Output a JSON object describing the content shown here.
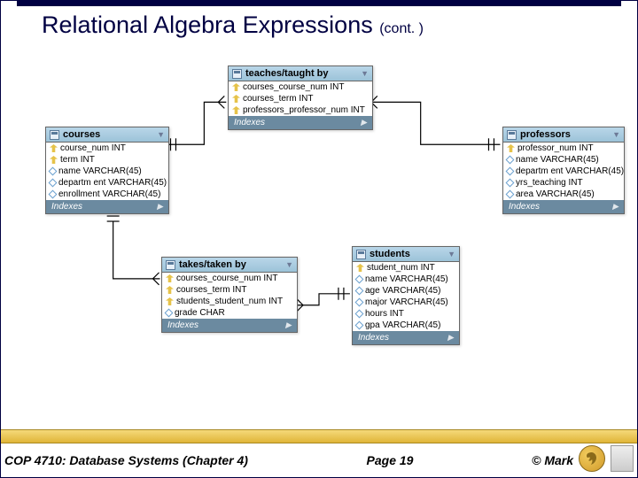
{
  "title_main": "Relational Algebra Expressions ",
  "title_cont": "(cont. )",
  "tables": {
    "courses": {
      "name": "courses",
      "idx": "Indexes",
      "cols": [
        {
          "k": "key",
          "t": "course_num INT"
        },
        {
          "k": "key",
          "t": "term INT"
        },
        {
          "k": "attr",
          "t": "name VARCHAR(45)"
        },
        {
          "k": "attr",
          "t": "departm ent VARCHAR(45)"
        },
        {
          "k": "attr",
          "t": "enrollment VARCHAR(45)"
        }
      ]
    },
    "teaches": {
      "name": "teaches/taught by",
      "idx": "Indexes",
      "cols": [
        {
          "k": "key",
          "t": "courses_course_num INT"
        },
        {
          "k": "key",
          "t": "courses_term INT"
        },
        {
          "k": "key",
          "t": "professors_professor_num INT"
        }
      ]
    },
    "professors": {
      "name": "professors",
      "idx": "Indexes",
      "cols": [
        {
          "k": "key",
          "t": "professor_num INT"
        },
        {
          "k": "attr",
          "t": "name VARCHAR(45)"
        },
        {
          "k": "attr",
          "t": "departm ent VARCHAR(45)"
        },
        {
          "k": "attr",
          "t": "yrs_teaching INT"
        },
        {
          "k": "attr",
          "t": "area VARCHAR(45)"
        }
      ]
    },
    "takes": {
      "name": "takes/taken by",
      "idx": "Indexes",
      "cols": [
        {
          "k": "key",
          "t": "courses_course_num INT"
        },
        {
          "k": "key",
          "t": "courses_term INT"
        },
        {
          "k": "key",
          "t": "students_student_num INT"
        },
        {
          "k": "attr",
          "t": "grade CHAR"
        }
      ]
    },
    "students": {
      "name": "students",
      "idx": "Indexes",
      "cols": [
        {
          "k": "key",
          "t": "student_num INT"
        },
        {
          "k": "attr",
          "t": "name VARCHAR(45)"
        },
        {
          "k": "attr",
          "t": "age VARCHAR(45)"
        },
        {
          "k": "attr",
          "t": "major VARCHAR(45)"
        },
        {
          "k": "attr",
          "t": "hours INT"
        },
        {
          "k": "attr",
          "t": "gpa VARCHAR(45)"
        }
      ]
    }
  },
  "footer": {
    "left": "COP 4710: Database Systems  (Chapter 4)",
    "center": "Page 19",
    "right": "© Mark"
  }
}
